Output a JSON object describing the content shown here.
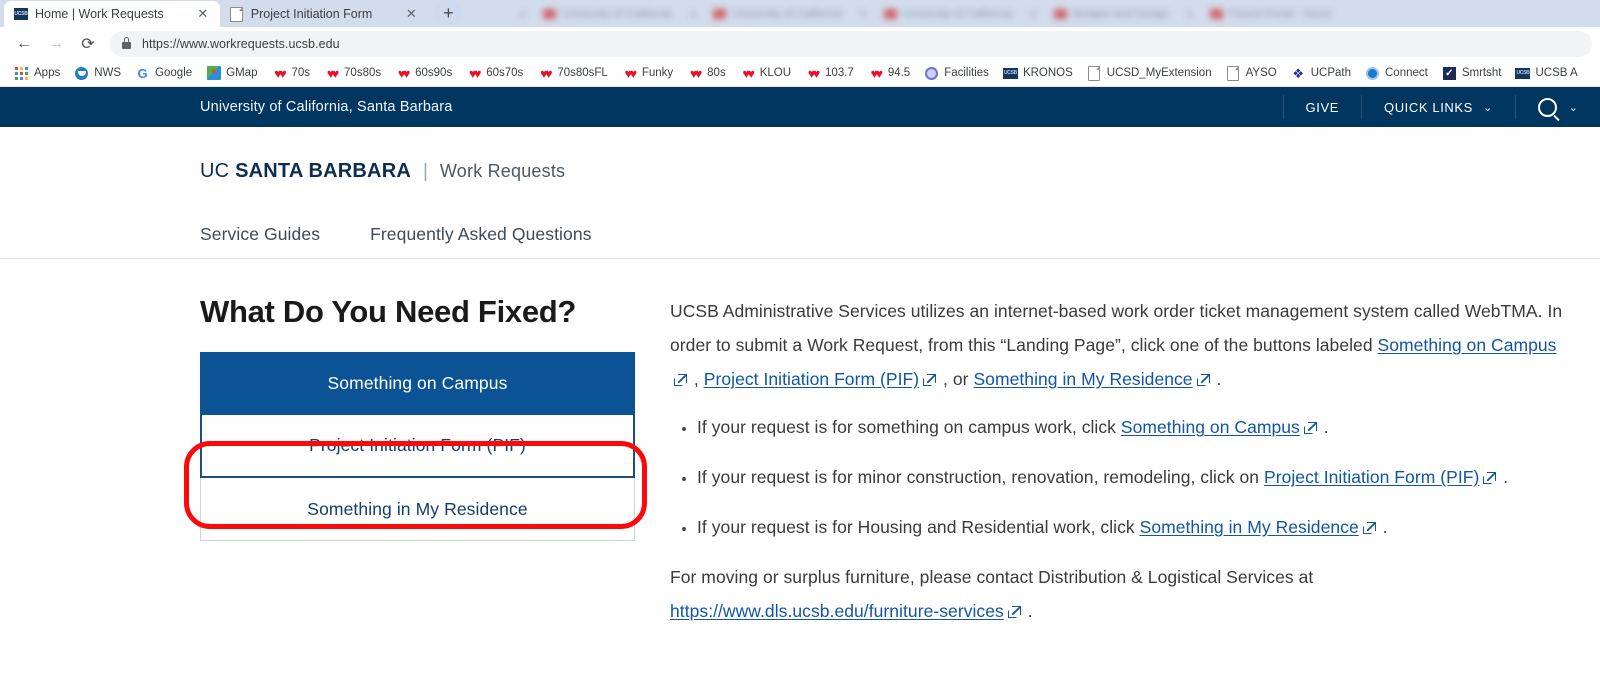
{
  "browser": {
    "tabs": [
      {
        "title": "Home | Work Requests",
        "favicon": "ucsb-icon",
        "active": true,
        "close_label": "✕"
      },
      {
        "title": "Project Initiation Form",
        "favicon": "document-icon",
        "active": false,
        "close_label": "✕"
      }
    ],
    "ghost_tabs": [
      {
        "title": "University of California"
      },
      {
        "title": "University of California"
      },
      {
        "title": "University of California"
      },
      {
        "title": "Bridges and Design"
      },
      {
        "title": "Parent Portal - Home"
      }
    ],
    "new_tab_label": "+",
    "nav": {
      "back_label": "←",
      "forward_label": "→",
      "reload_label": "⟳"
    },
    "omnibox": {
      "url": "https://www.workrequests.ucsb.edu",
      "security_icon": "lock-icon"
    },
    "bookmarks": [
      {
        "label": "Apps",
        "icon": "apps-grid-icon"
      },
      {
        "label": "NWS",
        "icon": "nws-icon"
      },
      {
        "label": "Google",
        "icon": "google-icon"
      },
      {
        "label": "GMap",
        "icon": "google-maps-icon"
      },
      {
        "label": "70s",
        "icon": "iheartradio-icon"
      },
      {
        "label": "70s80s",
        "icon": "iheartradio-icon"
      },
      {
        "label": "60s90s",
        "icon": "iheartradio-icon"
      },
      {
        "label": "60s70s",
        "icon": "iheartradio-icon"
      },
      {
        "label": "70s80sFL",
        "icon": "iheartradio-icon"
      },
      {
        "label": "Funky",
        "icon": "iheartradio-icon"
      },
      {
        "label": "80s",
        "icon": "iheartradio-icon"
      },
      {
        "label": "KLOU",
        "icon": "iheartradio-icon"
      },
      {
        "label": "103.7",
        "icon": "iheartradio-icon"
      },
      {
        "label": "94.5",
        "icon": "iheartradio-icon"
      },
      {
        "label": "Facilities",
        "icon": "purple-circle-icon"
      },
      {
        "label": "KRONOS",
        "icon": "ucsb-icon"
      },
      {
        "label": "UCSD_MyExtension",
        "icon": "document-icon"
      },
      {
        "label": "AYSO",
        "icon": "document-icon"
      },
      {
        "label": "UCPath",
        "icon": "ucpath-icon"
      },
      {
        "label": "Connect",
        "icon": "blue-circle-icon"
      },
      {
        "label": "Smrtsht",
        "icon": "checkmark-icon"
      },
      {
        "label": "UCSB A",
        "icon": "ucsb-icon"
      }
    ]
  },
  "uc_topbar": {
    "title": "University of California, Santa Barbara",
    "give_label": "GIVE",
    "quick_links_label": "QUICK LINKS",
    "chevron": "⌄",
    "search_icon": "search-icon",
    "search_chevron": "⌄"
  },
  "site_header": {
    "brand_uc": "UC",
    "brand_campus": "SANTA BARBARA",
    "divider": "|",
    "site_name": "Work Requests",
    "nav": [
      {
        "label": "Service Guides"
      },
      {
        "label": "Frequently Asked Questions"
      }
    ]
  },
  "main": {
    "heading": "What Do You Need Fixed?",
    "buttons": [
      {
        "label": "Something on Campus",
        "style": "primary"
      },
      {
        "label": "Project Initiation Form (PIF)",
        "style": "outline",
        "highlighted": true
      },
      {
        "label": "Something in My Residence",
        "style": "plain"
      }
    ],
    "annotation": {
      "shape": "rounded-rectangle",
      "color": "#fb0a0a",
      "targets": "Project Initiation Form (PIF)"
    },
    "intro": {
      "part1": "UCSB Administrative Services utilizes an internet-based work order ticket management system called WebTMA. In order to submit a Work Request, from this “Landing Page”, click one of the buttons labeled ",
      "link1": "Something on Campus",
      "sep1": " , ",
      "link2": "Project Initiation Form (PIF)",
      "sep2": " , or ",
      "link3": "Something in My Residence",
      "end": " ."
    },
    "bullets": [
      {
        "before": "If your request is for something on campus work, click ",
        "link": "Something on Campus",
        "after": " ."
      },
      {
        "before": "If your request is for minor construction, renovation, remodeling, click on ",
        "link": "Project Initiation Form (PIF)",
        "after": " ."
      },
      {
        "before": "If your request is for Housing and Residential work, click ",
        "link": "Something in My Residence",
        "after": " ."
      }
    ],
    "closing": {
      "before": "For moving or surplus furniture, please contact Distribution & Logistical Services at ",
      "link": "https://www.dls.ucsb.edu/furniture-services",
      "after": " ."
    }
  },
  "colors": {
    "uc_navy": "#003660",
    "button_blue": "#0b5394",
    "link_blue": "#1155a8",
    "annotation_red": "#fb0a0a"
  }
}
